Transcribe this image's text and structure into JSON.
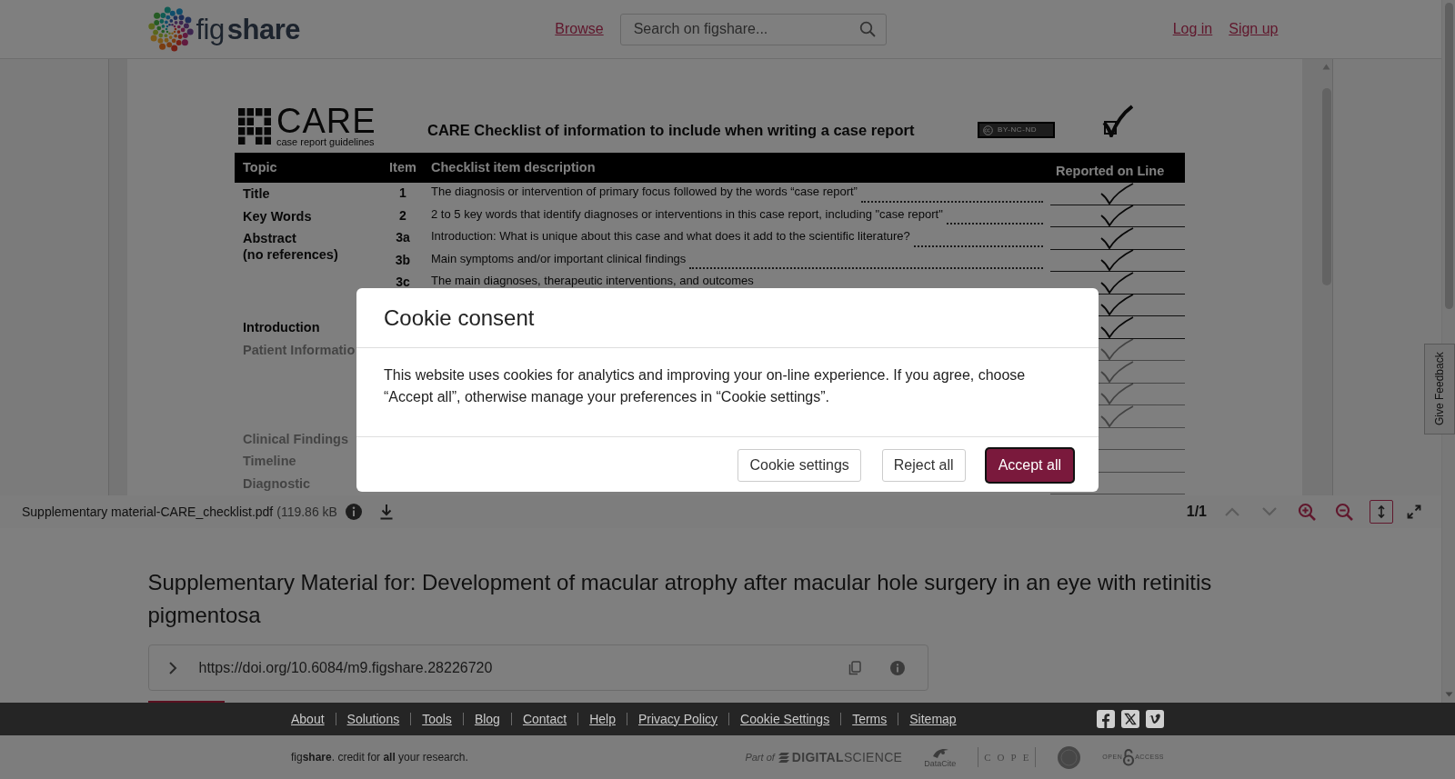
{
  "header": {
    "logo": "fig**share**",
    "nav_links": [
      {
        "label": "Browse"
      }
    ],
    "search": {
      "placeholder": "Search on figshare..."
    },
    "account_links": [
      {
        "label": "Log in"
      },
      {
        "label": "Sign up"
      }
    ]
  },
  "viewer": {
    "document": {
      "brand": "CARE",
      "brand_tagline": "case report guidelines",
      "title": "CARE Checklist of information to include when writing a case report",
      "license": "BY-NC-ND",
      "columns": [
        "Topic",
        "Item",
        "Checklist item description",
        "Reported on Line"
      ],
      "rows": [
        {
          "topic": "Title",
          "item": "1",
          "description": "The diagnosis or intervention of primary focus followed by the words “case report”",
          "checked": true
        },
        {
          "topic": "Key Words",
          "item": "2",
          "description": "2 to 5 key words that identify diagnoses or interventions in this case report, including \"case report\"",
          "checked": true
        },
        {
          "topic": "Abstract",
          "topic_note": "(no references)",
          "item": "3a",
          "description": "Introduction: What is unique about this case and what does it add to the scientific literature?",
          "checked": true
        },
        {
          "item": "3b",
          "description": "Main symptoms and/or important clinical findings",
          "checked": true
        },
        {
          "item": "3c",
          "description": "The main diagnoses, therapeutic interventions, and outcomes",
          "checked": true
        },
        {
          "checked": true
        },
        {
          "topic": "Introduction",
          "checked": true
        }
      ],
      "blurred_rows": [
        {
          "topic": "Patient Informatio",
          "checked": true
        },
        {
          "checked": true
        },
        {
          "checked": true
        },
        {
          "checked": true
        },
        {
          "topic": "Clinical Findings",
          "checked": false
        },
        {
          "topic": "Timeline",
          "checked": false
        },
        {
          "topic": "Diagnostic",
          "checked": false
        }
      ]
    },
    "toolbar": {
      "file_name": "Supplementary material-CARE_checklist.pdf",
      "file_size": "(119.86 kB",
      "page": "1/1",
      "previous_page": {
        "disabled": true
      },
      "next_page": {
        "disabled": true
      },
      "fit_height": {
        "selected": true
      }
    }
  },
  "item": {
    "title": "Supplementary Material for: Development of macular atrophy after macular hole surgery in an eye with retinitis pigmentosa",
    "doi": "https://doi.org/10.6084/m9.figshare.28226720"
  },
  "footer": {
    "links": [
      {
        "label": "About"
      },
      {
        "label": "Solutions"
      },
      {
        "label": "Tools"
      },
      {
        "label": "Blog"
      },
      {
        "label": "Contact"
      },
      {
        "label": "Help"
      },
      {
        "label": "Privacy Policy"
      },
      {
        "label": "Cookie Settings"
      },
      {
        "label": "Terms"
      },
      {
        "label": "Sitemap"
      }
    ],
    "tagline": "fig**share**. credit for **all** your research.",
    "partners": [
      {
        "kind": "digital-science",
        "prefix": "Part of",
        "name": "**DIGITAL**SCIENCE"
      },
      {
        "kind": "datacite",
        "name": "DataCite"
      },
      {
        "kind": "cope",
        "name": "COPE"
      },
      {
        "kind": "seal"
      },
      {
        "kind": "open-access",
        "name": "OPEN",
        "suffix": "ACCESS"
      }
    ]
  },
  "feedback_tab": {
    "label": "Give Feedback"
  },
  "cookie_modal": {
    "title": "Cookie consent",
    "body": "This website uses cookies for analytics and improving your on-line experience. If you agree, choose “Accept all”, otherwise manage your preferences in “Cookie settings”.",
    "buttons": [
      {
        "label": "Cookie settings",
        "kind": "outline",
        "focused": false
      },
      {
        "label": "Reject all",
        "kind": "outline",
        "focused": false
      },
      {
        "label": "Accept all",
        "kind": "primary",
        "focused": true
      }
    ]
  }
}
